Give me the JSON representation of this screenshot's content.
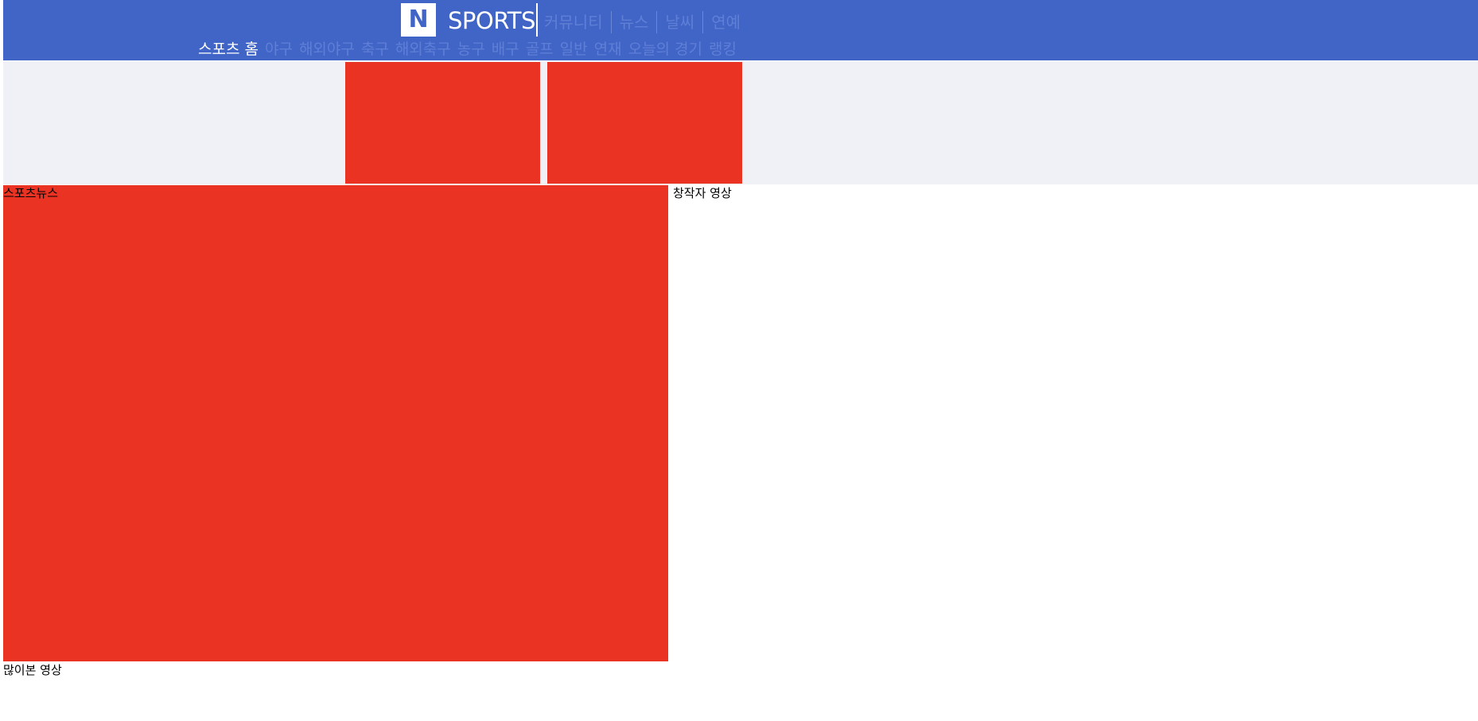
{
  "header": {
    "logo_letter": "N",
    "brand": "SPORTS",
    "gnb": [
      "커뮤니티",
      "뉴스",
      "날씨",
      "연예"
    ]
  },
  "lnb": {
    "items": [
      "스포츠 홈",
      "야구",
      "해외야구",
      "축구",
      "해외축구",
      "농구",
      "배구",
      "골프",
      "일반",
      "연재",
      "오늘의 경기",
      "랭킹"
    ],
    "active_index": 0
  },
  "sections": {
    "news_title": "스포츠뉴스",
    "creator_title": "창작자 영상",
    "popular_title": "많이본 영상"
  },
  "colors": {
    "header_bg": "#4165c7",
    "banner_bg": "#eff1f7",
    "placeholder_red": "#ea3323"
  }
}
